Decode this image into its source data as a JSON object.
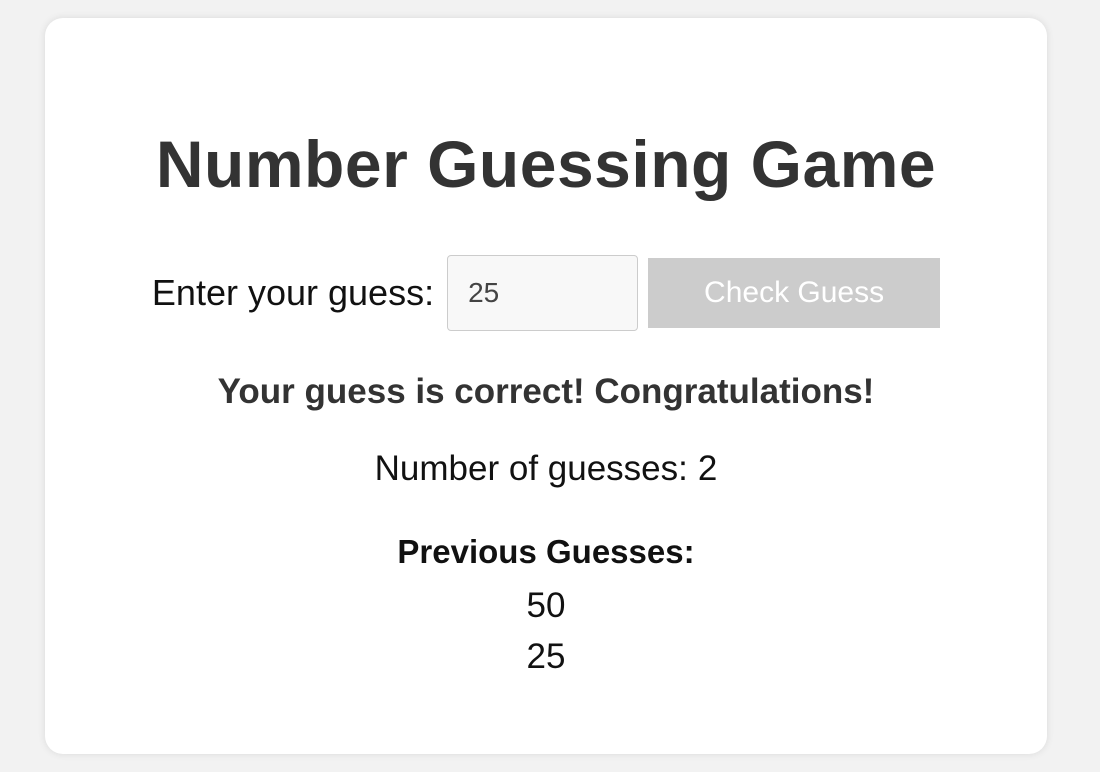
{
  "game": {
    "title": "Number Guessing Game",
    "input_label": "Enter your guess:",
    "input_value": "25",
    "check_button_label": "Check Guess",
    "result_message": "Your guess is correct! Congratulations!",
    "guess_count_label": "Number of guesses:",
    "guess_count": "2",
    "history_title": "Previous Guesses:",
    "previous_guesses": [
      "50",
      "25"
    ]
  },
  "colors": {
    "page_background": "#f2f2f2",
    "card_background": "#ffffff",
    "heading_text": "#333333",
    "disabled_button": "#cccccc"
  }
}
